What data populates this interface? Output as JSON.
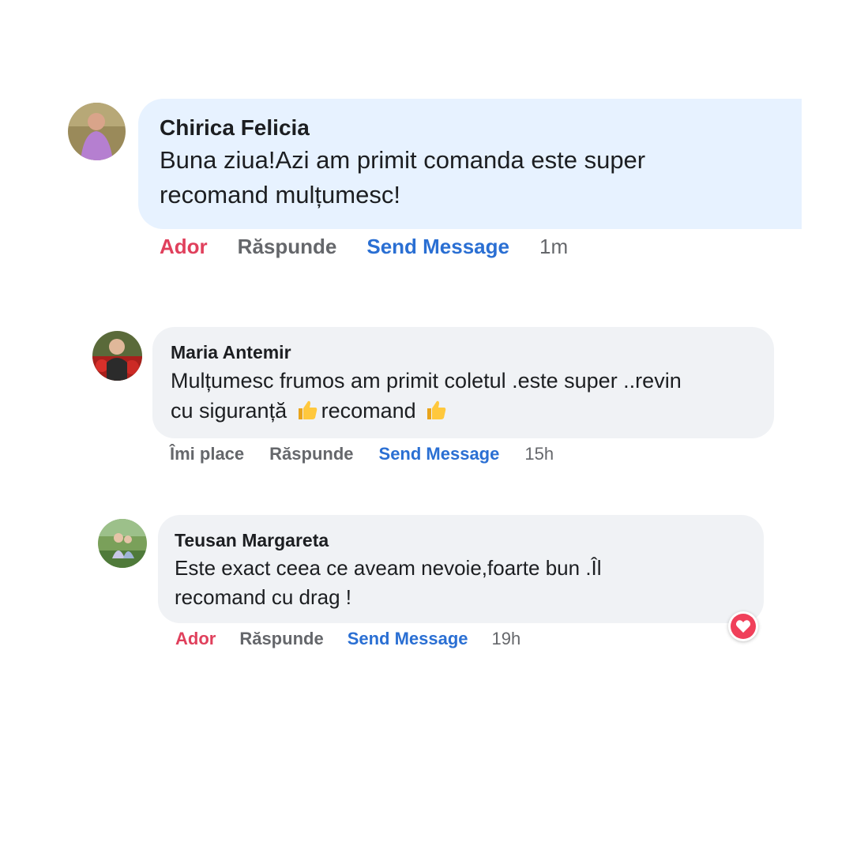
{
  "comments": [
    {
      "author": "Chirica Felicia",
      "text_lines": [
        "Buna ziua!Azi am primit comanda este super",
        "recomand mulțumesc!"
      ],
      "actions": {
        "like": "Ador",
        "reply": "Răspunde",
        "message": "Send Message",
        "time": "1m"
      }
    },
    {
      "author": "Maria Antemir",
      "line1": "Mulțumesc frumos am primit coletul .este super ..revin",
      "line2_a": "cu siguranță",
      "line2_b": "recomand",
      "emoji": "thumbs-up-icon",
      "actions": {
        "like": "Îmi place",
        "reply": "Răspunde",
        "message": "Send Message",
        "time": "15h"
      }
    },
    {
      "author": "Teusan Margareta",
      "text_lines": [
        "Este exact ceea ce aveam nevoie,foarte bun .Îl",
        "recomand cu drag !"
      ],
      "actions": {
        "like": "Ador",
        "reply": "Răspunde",
        "message": "Send Message",
        "time": "19h"
      },
      "reaction": "heart-reaction-icon"
    }
  ],
  "colors": {
    "bubble_blue": "#e7f2ff",
    "bubble_grey": "#f0f2f5",
    "like_red": "#e0405c",
    "link_blue": "#2a6fd3",
    "meta_grey": "#65676b"
  }
}
